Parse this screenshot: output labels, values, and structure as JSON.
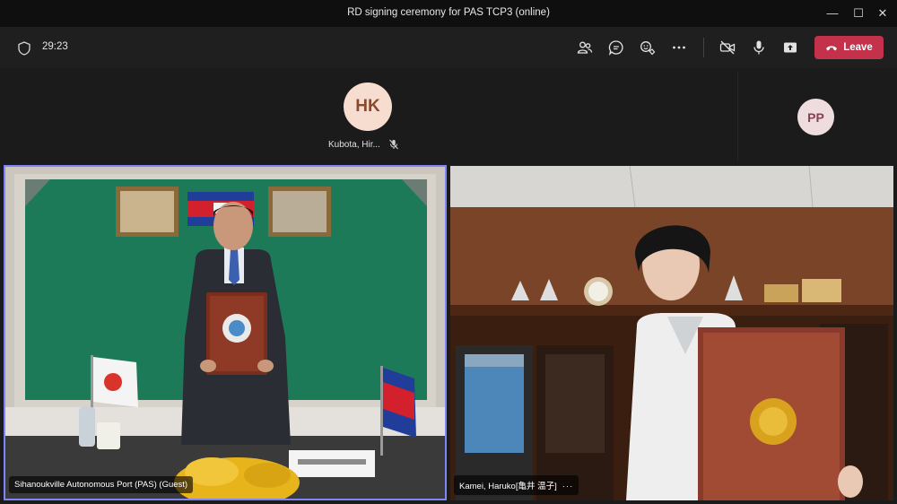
{
  "window": {
    "title": "RD signing ceremony for PAS TCP3 (online)",
    "minimize": "—",
    "maximize": "☐",
    "close": "✕"
  },
  "toolbar": {
    "timer": "29:23",
    "leave_label": "Leave",
    "icons": [
      "people-icon",
      "chat-icon",
      "reactions-icon",
      "more-icon",
      "camera-off-icon",
      "mic-icon",
      "share-icon"
    ],
    "leave_color": "#c4314b"
  },
  "participants": {
    "hk": {
      "initials": "HK",
      "name": "Kubota, Hir..."
    },
    "pp": {
      "initials": "PP"
    }
  },
  "tiles": {
    "left": {
      "name": "Sihanoukville Autonomous Port (PAS) (Guest)",
      "highlight_color": "#7f85f5"
    },
    "right": {
      "name": "Kamei, Haruko[亀井 温子]",
      "more": "···"
    }
  }
}
